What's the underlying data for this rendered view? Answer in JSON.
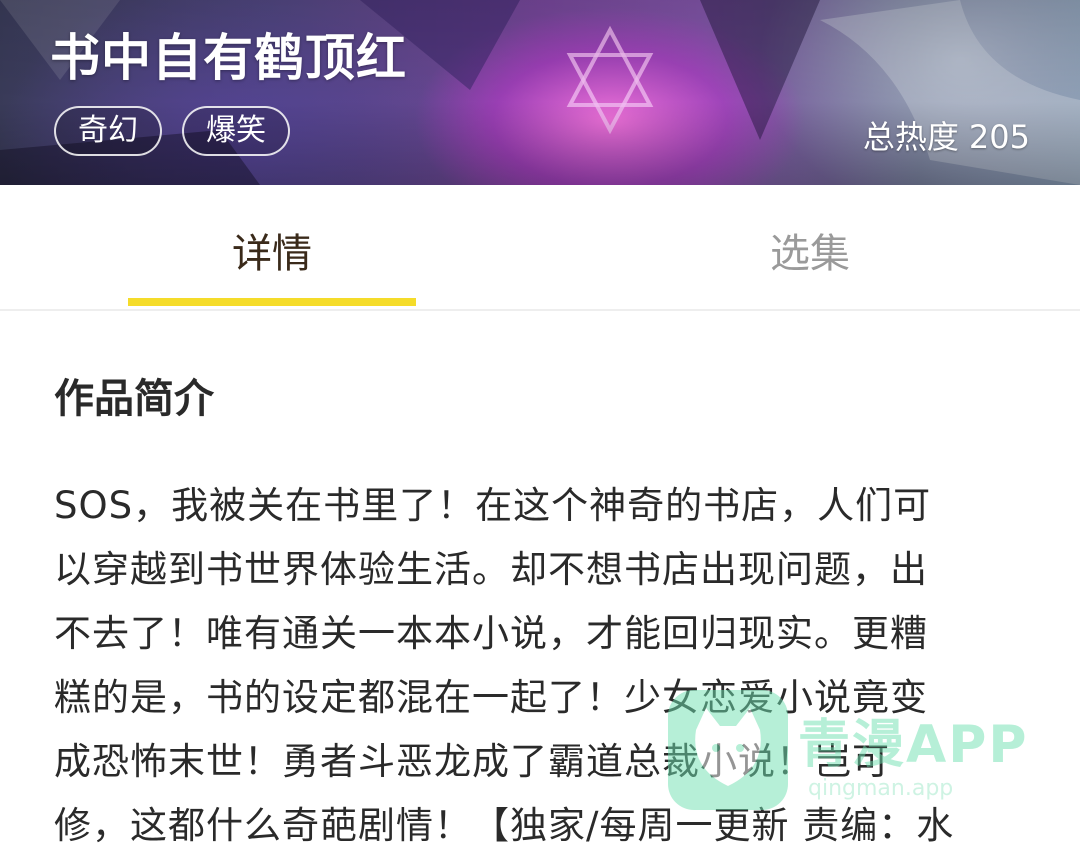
{
  "banner": {
    "title": "书中自有鹤顶红",
    "tags": [
      "奇幻",
      "爆笑"
    ],
    "heat_label": "总热度",
    "heat_value": "205"
  },
  "tabs": [
    {
      "label": "详情",
      "active": true
    },
    {
      "label": "选集",
      "active": false
    }
  ],
  "tab_underline_color": "#f5dc2a",
  "intro": {
    "title": "作品简介",
    "lines": [
      "SOS，我被关在书里了！在这个神奇的书店，人们可",
      "以穿越到书世界体验生活。却不想书店出现问题，出",
      "不去了！唯有通关一本本小说，才能回归现实。更糟",
      "糕的是，书的设定都混在一起了！少女恋爱小说竟变",
      "成恐怖末世！勇者斗恶龙成了霸道总裁小说！岂可",
      "修，这都什么奇葩剧情！【独家/每周一更新 责编：水"
    ]
  },
  "watermark": {
    "icon": "cat-logo-icon",
    "text": "青漫APP",
    "url": "qingman.app"
  }
}
